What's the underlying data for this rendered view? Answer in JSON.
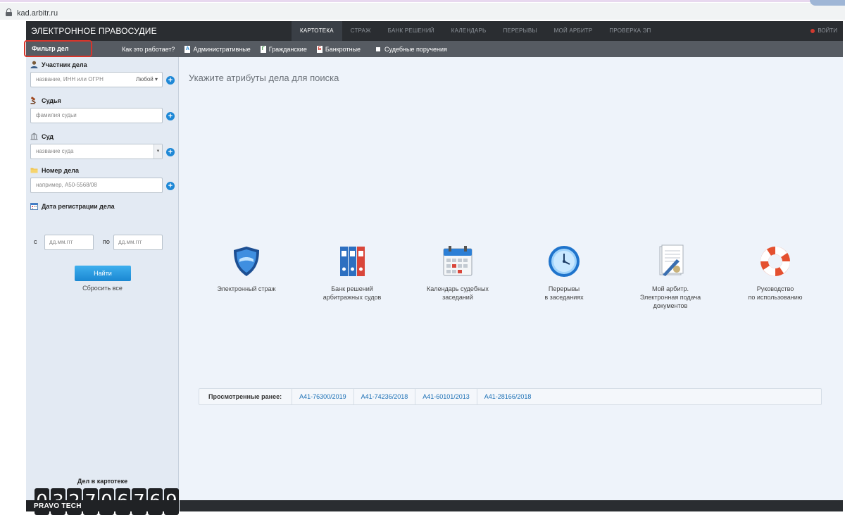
{
  "browser": {
    "url": "kad.arbitr.ru"
  },
  "header": {
    "logo": "ЭЛЕКТРОННОЕ ПРАВОСУДИЕ",
    "nav": [
      {
        "label": "КАРТОТЕКА",
        "active": true
      },
      {
        "label": "СТРАЖ",
        "active": false
      },
      {
        "label": "БАНК РЕШЕНИЙ",
        "active": false
      },
      {
        "label": "КАЛЕНДАРЬ",
        "active": false
      },
      {
        "label": "ПЕРЕРЫВЫ",
        "active": false
      },
      {
        "label": "МОЙ АРБИТР",
        "active": false
      },
      {
        "label": "ПРОВЕРКА ЭП",
        "active": false
      }
    ],
    "login": "ВОЙТИ"
  },
  "subbar": {
    "filter_tab": "Фильтр дел",
    "how_it_works": "Как это работает?",
    "links": [
      {
        "label": "Административные",
        "icon": "A"
      },
      {
        "label": "Гражданские",
        "icon": "Г"
      },
      {
        "label": "Банкротные",
        "icon": "Б"
      }
    ],
    "court_orders": "Судебные поручения"
  },
  "sidebar": {
    "participant_label": "Участник дела",
    "participant_placeholder": "название, ИНН или ОГРН",
    "participant_type": "Любой",
    "judge_label": "Судья",
    "judge_placeholder": "фамилия судьи",
    "court_label": "Суд",
    "court_placeholder": "название суда",
    "case_number_label": "Номер дела",
    "case_number_placeholder": "например, А50-5568/08",
    "date_label": "Дата регистрации дела",
    "date_from_label": "с",
    "date_to_label": "по",
    "date_placeholder": "дд.мм.ггг",
    "find_button": "Найти",
    "reset_link": "Сбросить все",
    "counter_label": "Дел в картотеке",
    "counter_digits": [
      "0",
      "3",
      "2",
      "7",
      "0",
      "6",
      "7",
      "6",
      "9"
    ],
    "brand": "PRAVO TECH"
  },
  "main": {
    "title": "Укажите атрибуты дела для поиска",
    "tiles": [
      {
        "line1": "Электронный страж",
        "line2": "",
        "line3": "",
        "icon": "shield-icon"
      },
      {
        "line1": "Банк решений",
        "line2": "арбитражных судов",
        "line3": "",
        "icon": "binders-icon"
      },
      {
        "line1": "Календарь судебных",
        "line2": "заседаний",
        "line3": "",
        "icon": "calendar-icon"
      },
      {
        "line1": "Перерывы",
        "line2": "в заседаниях",
        "line3": "",
        "icon": "clock-icon"
      },
      {
        "line1": "Мой арбитр.",
        "line2": "Электронная подача",
        "line3": "документов",
        "icon": "document-pen-icon"
      },
      {
        "line1": "Руководство",
        "line2": "по использованию",
        "line3": "",
        "icon": "lifebuoy-icon"
      }
    ],
    "recent_label": "Просмотренные ранее:",
    "recent_cases": [
      "А41-76300/2019",
      "А41-74236/2018",
      "А41-60101/2013",
      "А41-28166/2018"
    ]
  },
  "colors": {
    "topbar": "#2a2d31",
    "subbar": "#565b62",
    "accent_blue": "#1e88d6",
    "highlight_red": "#d8352b",
    "link": "#1a6fb5"
  }
}
